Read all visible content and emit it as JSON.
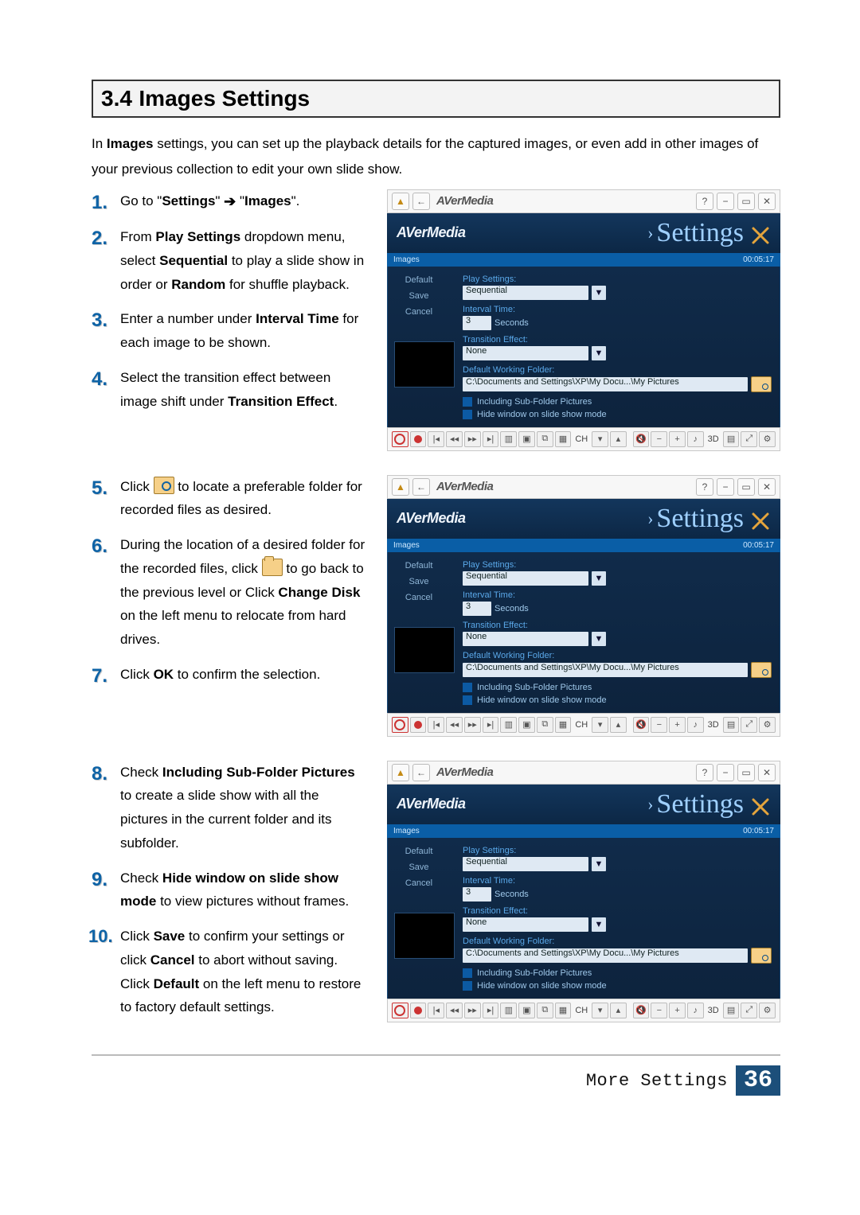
{
  "heading": {
    "number": "3.4",
    "title": "Images Settings"
  },
  "intro_prefix": "In ",
  "intro_bold": "Images",
  "intro_rest": " settings, you can set up the playback details for the captured images, or even add in other images of your previous collection to edit your own slide show.",
  "steps": {
    "s1a": "Go to \"",
    "s1b": "Settings",
    "s1c": "\" ",
    "s1arrow": "➔",
    "s1d": " \"",
    "s1e": "Images",
    "s1f": "\".",
    "s2a": "From ",
    "s2b": "Play Settings",
    "s2c": " dropdown menu, select ",
    "s2d": "Sequential",
    "s2e": " to play a slide show in order or ",
    "s2f": "Random",
    "s2g": " for shuffle playback.",
    "s3a": "Enter a number under ",
    "s3b": "Interval Time",
    "s3c": " for each image to be shown.",
    "s4a": "Select the transition effect between image shift under ",
    "s4b": "Transition Effect",
    "s4c": ".",
    "s5a": "Click ",
    "s5b": " to locate a preferable folder for recorded files as desired.",
    "s6a": "During the location of a desired folder for the recorded files, click ",
    "s6b": " to go back to the previous level or Click ",
    "s6c": "Change Disk",
    "s6d": " on the left menu to relocate from hard drives.",
    "s7a": "Click ",
    "s7b": "OK",
    "s7c": " to confirm the selection.",
    "s8a": "Check ",
    "s8b": "Including Sub-Folder Pictures",
    "s8c": " to create a slide show with all the pictures in the current folder and its subfolder.",
    "s9a": "Check ",
    "s9b": "Hide window on slide show mode",
    "s9c": " to view pictures without frames.",
    "s10a": "Click ",
    "s10b": "Save",
    "s10c": " to confirm your settings or click ",
    "s10d": "Cancel",
    "s10e": " to abort without saving. Click ",
    "s10f": "Default",
    "s10g": " on the left menu to restore to factory default settings."
  },
  "shot": {
    "brand": "AVerMedia",
    "banner_brand": "AVerMedia",
    "title": "Settings",
    "stripe_left": "Images",
    "stripe_right": "00:05:17",
    "sidebar": {
      "default": "Default",
      "save": "Save",
      "cancel": "Cancel"
    },
    "labels": {
      "play": "Play Settings:",
      "interval": "Interval Time:",
      "seconds": "Seconds",
      "transition": "Transition Effect:",
      "folder": "Default Working Folder:"
    },
    "values": {
      "play": "Sequential",
      "interval": "3",
      "transition": "None",
      "folder": "C:\\Documents and Settings\\XP\\My Docu...\\My Pictures"
    },
    "checks": {
      "sub": "Including Sub-Folder Pictures",
      "hide": "Hide window on slide show mode"
    },
    "titlebar": {
      "help": "?",
      "min": "−",
      "max": "▭",
      "close": "✕",
      "back": "←",
      "logo": "▲"
    },
    "bottom": {
      "ch": "CH",
      "threeD": "3D"
    }
  },
  "footer": {
    "label": "More Settings",
    "page": "36"
  }
}
